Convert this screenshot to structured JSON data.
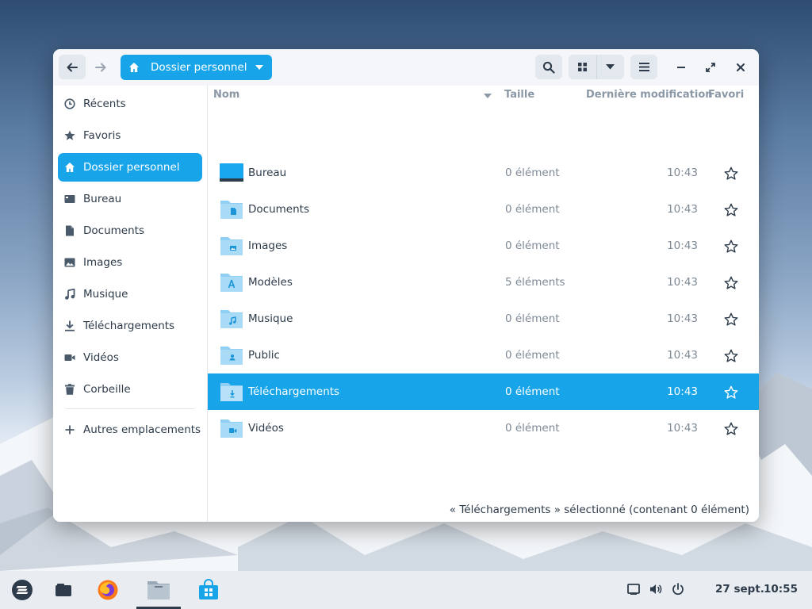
{
  "window": {
    "location": "Dossier personnel"
  },
  "sidebar": {
    "items": [
      {
        "label": "Récents",
        "icon": "clock-icon"
      },
      {
        "label": "Favoris",
        "icon": "star-icon"
      },
      {
        "label": "Dossier personnel",
        "icon": "home-icon",
        "selected": true
      },
      {
        "label": "Bureau",
        "icon": "desktop-icon"
      },
      {
        "label": "Documents",
        "icon": "document-icon"
      },
      {
        "label": "Images",
        "icon": "image-icon"
      },
      {
        "label": "Musique",
        "icon": "music-icon"
      },
      {
        "label": "Téléchargements",
        "icon": "download-icon"
      },
      {
        "label": "Vidéos",
        "icon": "video-icon"
      },
      {
        "label": "Corbeille",
        "icon": "trash-icon"
      }
    ],
    "other_locations": "Autres emplacements"
  },
  "columns": {
    "name": "Nom",
    "size": "Taille",
    "modified": "Dernière modification",
    "favorite": "Favori"
  },
  "files": [
    {
      "name": "Bureau",
      "size": "0 élément",
      "time": "10:43",
      "icon": "desktop-folder-icon"
    },
    {
      "name": "Documents",
      "size": "0 élément",
      "time": "10:43",
      "icon": "documents-folder-icon"
    },
    {
      "name": "Images",
      "size": "0 élément",
      "time": "10:43",
      "icon": "pictures-folder-icon"
    },
    {
      "name": "Modèles",
      "size": "5 éléments",
      "time": "10:43",
      "icon": "templates-folder-icon"
    },
    {
      "name": "Musique",
      "size": "0 élément",
      "time": "10:43",
      "icon": "music-folder-icon"
    },
    {
      "name": "Public",
      "size": "0 élément",
      "time": "10:43",
      "icon": "public-folder-icon"
    },
    {
      "name": "Téléchargements",
      "size": "0 élément",
      "time": "10:43",
      "icon": "downloads-folder-icon",
      "selected": true
    },
    {
      "name": "Vidéos",
      "size": "0 élément",
      "time": "10:43",
      "icon": "videos-folder-icon"
    }
  ],
  "status": "« Téléchargements » sélectionné  (contenant 0 élément)",
  "taskbar": {
    "date": "27 sept.",
    "time": "10:55"
  },
  "colors": {
    "accent": "#17a4e8",
    "folder": "#8ecff3"
  }
}
